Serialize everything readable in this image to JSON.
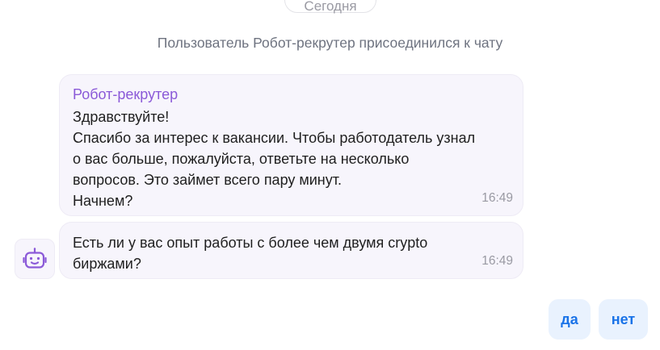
{
  "chat": {
    "date_label": "Сегодня",
    "system_message": "Пользователь Робот-рекрутер присоединился к чату"
  },
  "messages": [
    {
      "sender": "Робот-рекрутер",
      "lines": [
        "Здравствуйте!",
        "Спасибо за интерес к вакансии. Чтобы работодатель узнал",
        "о вас больше, пожалуйста, ответьте на несколько",
        "вопросов. Это займет всего пару минут.",
        "Начнем?"
      ],
      "time": "16:49"
    },
    {
      "lines": [
        "Есть ли у вас опыт работы с более чем двумя crypto",
        "биржами?"
      ],
      "time": "16:49"
    }
  ],
  "avatar": {
    "icon": "robot-icon",
    "color": "#8b5ad8"
  },
  "quick_replies": {
    "yes_label": "да",
    "no_label": "нет"
  },
  "colors": {
    "accent": "#8b5ad8",
    "reply_text": "#1a73e8",
    "reply_bg": "#e9f2fe",
    "bubble_bg": "#f7f5fc"
  }
}
